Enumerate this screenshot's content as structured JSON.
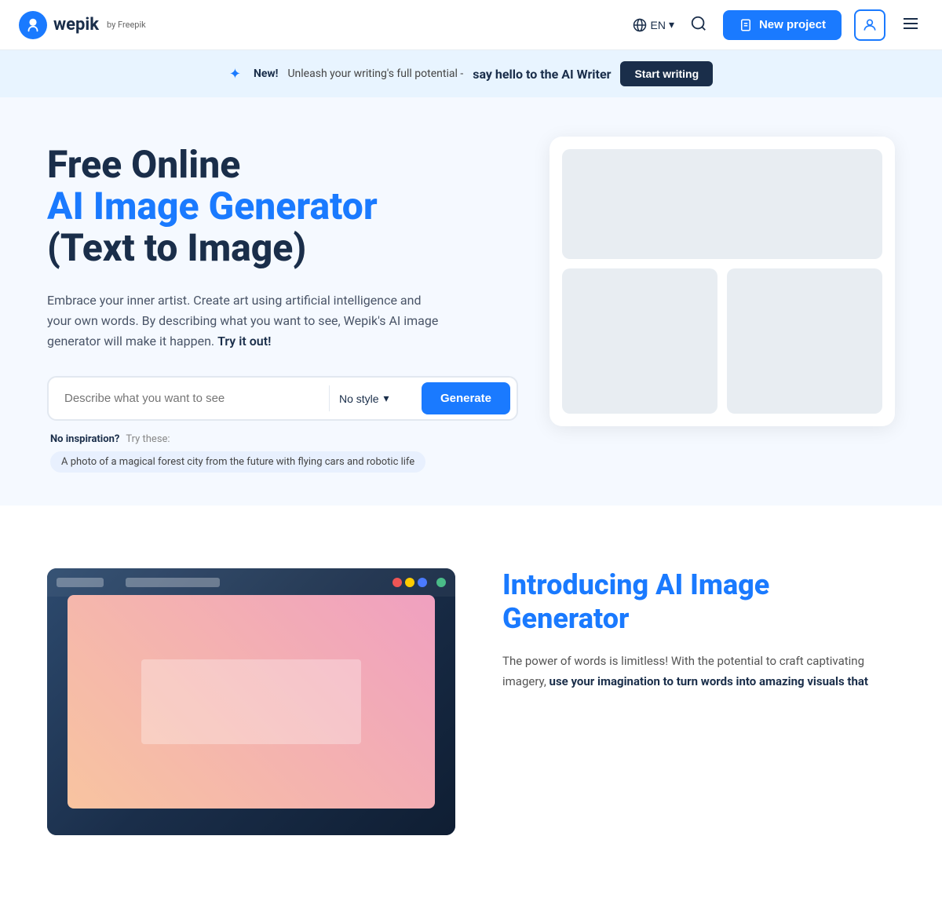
{
  "navbar": {
    "logo_text": "wepik",
    "logo_by": "by Freepik",
    "lang": "EN",
    "new_project_label": "New project",
    "menu_icon": "☰"
  },
  "banner": {
    "sparkle": "✦",
    "new_label": "New!",
    "text": "Unleash your writing's full potential - ",
    "link_text": "say hello to the AI Writer",
    "cta_label": "Start writing"
  },
  "hero": {
    "title_line1": "Free Online",
    "title_line2": "AI Image Generator",
    "title_line3": "(Text to Image)",
    "description": "Embrace your inner artist. Create art using artificial intelligence and your own words. By describing what you want to see, Wepik's AI image generator will make it happen.",
    "try_link": "Try it out!",
    "input_placeholder": "Describe what you want to see",
    "style_label": "No style",
    "generate_label": "Generate",
    "no_inspiration": "No inspiration?",
    "try_these": "Try these:",
    "inspiration_tag": "A photo of a magical forest city from the future with flying cars and robotic life"
  },
  "introducing": {
    "title": "Introducing AI Image Generator",
    "desc_part1": "The power of words is limitless! With the potential to craft captivating imagery, ",
    "desc_bold": "use your imagination to turn words into amazing visuals that"
  }
}
